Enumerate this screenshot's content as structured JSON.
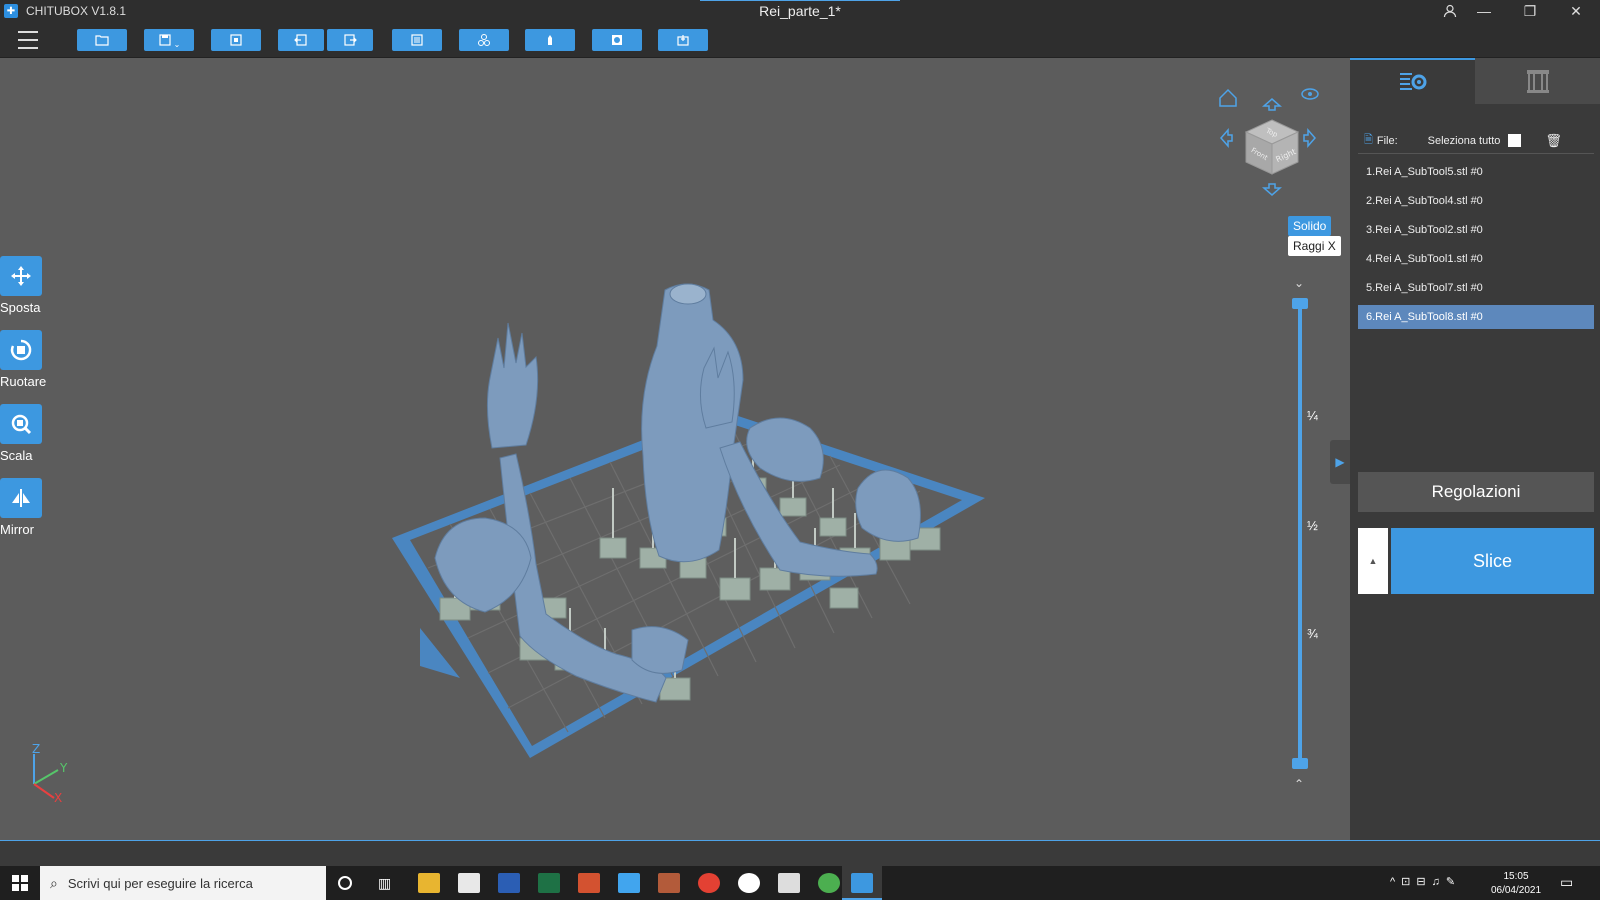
{
  "window": {
    "app_title": "CHITUBOX V1.8.1",
    "document_title": "Rei_parte_1*"
  },
  "toolbar": {
    "buttons": [
      "open-file-icon",
      "save-icon",
      "import-icon",
      "undo-icon",
      "redo-icon",
      "layout-icon",
      "auto-arrange-icon",
      "support-icon",
      "hollow-icon",
      "drill-icon"
    ]
  },
  "left_tools": [
    {
      "label": "Sposta",
      "icon": "move-icon"
    },
    {
      "label": "Ruotare",
      "icon": "rotate-icon"
    },
    {
      "label": "Scala",
      "icon": "scale-icon"
    },
    {
      "label": "Mirror",
      "icon": "mirror-icon"
    }
  ],
  "view_cube": {
    "faces": [
      "Top",
      "Front",
      "Right"
    ]
  },
  "view_mode": {
    "solid": "Solido",
    "xray": "Raggi X"
  },
  "layer_slider": {
    "marks": [
      "¼",
      "½",
      "¾"
    ]
  },
  "axes": {
    "z": "Z",
    "y": "Y",
    "x": "X"
  },
  "right_panel": {
    "file_label": "File:",
    "select_all": "Seleziona tutto",
    "files": [
      "1.Rei A_SubTool5.stl #0",
      "2.Rei A_SubTool4.stl #0",
      "3.Rei A_SubTool2.stl #0",
      "4.Rei A_SubTool1.stl #0",
      "5.Rei A_SubTool7.stl #0",
      "6.Rei A_SubTool8.stl #0"
    ],
    "selected_index": 5,
    "adjust_button": "Regolazioni",
    "slice_button": "Slice"
  },
  "taskbar": {
    "search_placeholder": "Scrivi qui per eseguire la ricerca",
    "time": "15:05",
    "date": "06/04/2021"
  },
  "colors": {
    "accent": "#3d98e0",
    "model": "#7d9bbd",
    "platform": "#4a86c1"
  }
}
